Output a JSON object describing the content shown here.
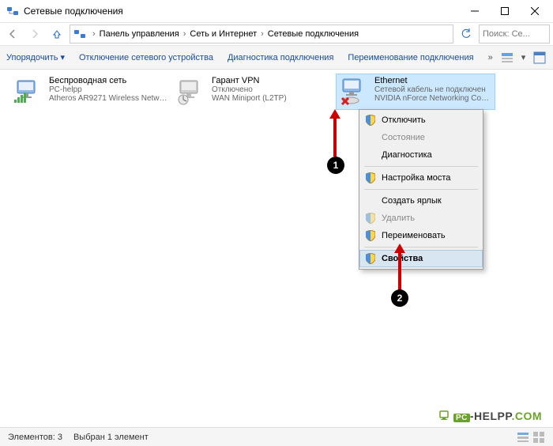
{
  "title": "Сетевые подключения",
  "breadcrumbs": [
    "Панель управления",
    "Сеть и Интернет",
    "Сетевые подключения"
  ],
  "search_placeholder": "Поиск: Се...",
  "cmdbar": {
    "organize": "Упорядочить",
    "disable": "Отключение сетевого устройства",
    "diagnose": "Диагностика подключения",
    "rename": "Переименование подключения"
  },
  "adapters": {
    "wifi": {
      "name": "Беспроводная сеть",
      "line2": "PC-helpp",
      "line3": "Atheros AR9271 Wireless Network..."
    },
    "vpn": {
      "name": "Гарант VPN",
      "line2": "Отключено",
      "line3": "WAN Miniport (L2TP)"
    },
    "eth": {
      "name": "Ethernet",
      "line2": "Сетевой кабель не подключен",
      "line3": "NVIDIA nForce Networking Contr..."
    }
  },
  "context_menu": {
    "disable": "Отключить",
    "status": "Состояние",
    "diag": "Диагностика",
    "bridge": "Настройка моста",
    "shortcut": "Создать ярлык",
    "delete": "Удалить",
    "rename": "Переименовать",
    "properties": "Свойства"
  },
  "statusbar": {
    "count": "Элементов: 3",
    "selected": "Выбран 1 элемент"
  },
  "annotations": {
    "badge1": "1",
    "badge2": "2"
  },
  "watermark": {
    "pc": "PC",
    "rest": "-HELPP",
    "com": ".COM"
  }
}
